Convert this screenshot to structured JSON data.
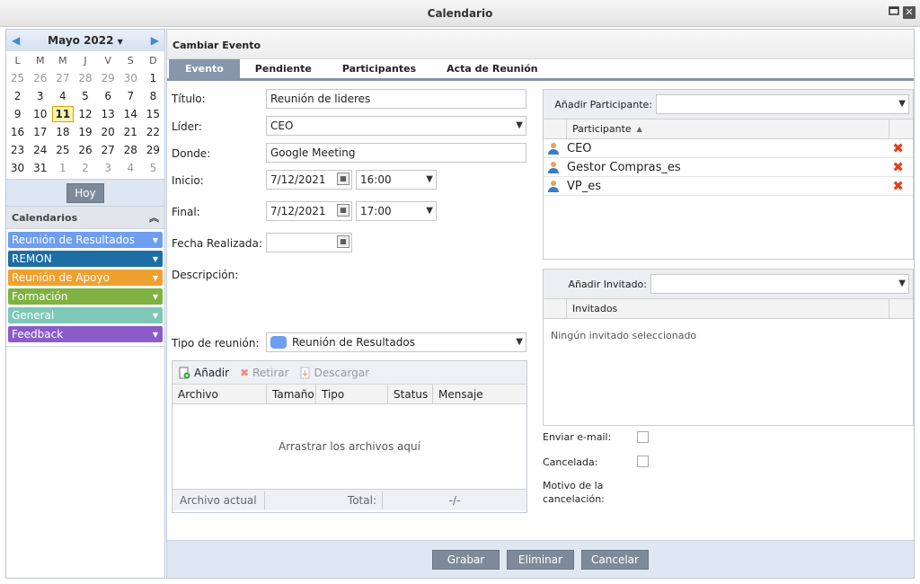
{
  "window": {
    "title": "Calendario",
    "restore_icon": "restore-icon",
    "close_icon": "close-icon"
  },
  "calendar": {
    "month_label": "Mayo 2022",
    "weekdays": [
      "L",
      "M",
      "M",
      "J",
      "V",
      "S",
      "D"
    ],
    "weeks": [
      [
        "25",
        "26",
        "27",
        "28",
        "29",
        "30",
        "1"
      ],
      [
        "2",
        "3",
        "4",
        "5",
        "6",
        "7",
        "8"
      ],
      [
        "9",
        "10",
        "11",
        "12",
        "13",
        "14",
        "15"
      ],
      [
        "16",
        "17",
        "18",
        "19",
        "20",
        "21",
        "22"
      ],
      [
        "23",
        "24",
        "25",
        "26",
        "27",
        "28",
        "29"
      ],
      [
        "30",
        "31",
        "1",
        "2",
        "3",
        "4",
        "5"
      ]
    ],
    "today": "11",
    "today_button": "Hoy"
  },
  "calendars": {
    "heading": "Calendarios",
    "items": [
      {
        "label": "Reunión de Resultados",
        "color": "#6d9ef0"
      },
      {
        "label": "REMON",
        "color": "#1c6ea4"
      },
      {
        "label": "Reunión de Apoyo",
        "color": "#f0a02e"
      },
      {
        "label": "Formación",
        "color": "#7fb241"
      },
      {
        "label": "General",
        "color": "#7ec8b8"
      },
      {
        "label": "Feedback",
        "color": "#8a5cc9"
      }
    ]
  },
  "editor": {
    "heading": "Cambiar Evento",
    "tabs": [
      "Evento",
      "Pendiente",
      "Participantes",
      "Acta de Reunión"
    ],
    "fields": {
      "titulo_label": "Título:",
      "titulo_value": "Reunión de lideres",
      "lider_label": "Líder:",
      "lider_value": "CEO",
      "donde_label": "Donde:",
      "donde_value": "Google Meeting",
      "inicio_label": "Inicio:",
      "inicio_date": "7/12/2021",
      "inicio_time": "16:00",
      "final_label": "Final:",
      "final_date": "7/12/2021",
      "final_time": "17:00",
      "fecha_realizada_label": "Fecha Realizada:",
      "fecha_realizada_value": "",
      "descripcion_label": "Descripción:",
      "tipo_label": "Tipo de reunión:",
      "tipo_value": "Reunión de Resultados",
      "tipo_color": "#6d9ef0"
    },
    "files": {
      "toolbar": {
        "add": "Añadir",
        "remove": "Retirar",
        "download": "Descargar"
      },
      "columns": [
        "Archivo",
        "Tamaño",
        "Tipo",
        "Status",
        "Mensaje"
      ],
      "drop_text": "Arrastrar los archivos aquí",
      "footer": {
        "current": "Archivo actual",
        "total": "Total:",
        "value": "-/-"
      }
    },
    "participants": {
      "add_label": "Añadir Participante:",
      "column": "Participante",
      "sort_icon": "sort-ascending-icon",
      "rows": [
        "CEO",
        "Gestor Compras_es",
        "VP_es"
      ]
    },
    "guests": {
      "add_label": "Añadir Invitado:",
      "column": "Invitados",
      "empty": "Ningún invitado seleccionado"
    },
    "options": {
      "email_label": "Enviar e-mail:",
      "cancelada_label": "Cancelada:",
      "motivo_label_1": "Motivo de la",
      "motivo_label_2": "cancelación:"
    },
    "buttons": {
      "save": "Grabar",
      "delete": "Eliminar",
      "cancel": "Cancelar"
    }
  }
}
